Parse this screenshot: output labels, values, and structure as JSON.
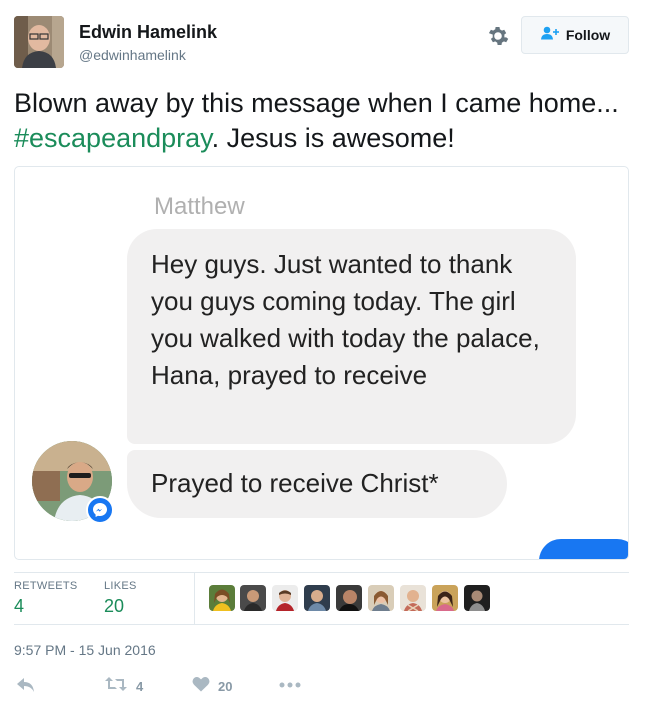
{
  "author": {
    "name": "Edwin Hamelink",
    "handle": "@edwinhamelink"
  },
  "header": {
    "follow_label": "Follow"
  },
  "tweet": {
    "text_before": "Blown away by this message when I came home... ",
    "hashtag": "#escapeandpray",
    "text_after": ". Jesus is awesome!"
  },
  "media": {
    "sender_name": "Matthew",
    "messages": [
      "Hey guys. Just wanted to thank you guys coming today. The girl you walked with today the palace, Hana, prayed to receive",
      "Prayed to receive Christ*"
    ]
  },
  "stats": {
    "retweets_label": "RETWEETS",
    "retweets_value": "4",
    "likes_label": "LIKES",
    "likes_value": "20"
  },
  "timestamp": "9:57 PM - 15 Jun 2016",
  "actions": {
    "retweet_count": "4",
    "like_count": "20"
  },
  "colors": {
    "hashtag": "#1b8c5a",
    "stat_value": "#1b8c5a",
    "messenger_blue": "#1877f2",
    "bubble_gray": "#f1f0f0"
  },
  "icons": [
    "gear-icon",
    "follow-person-icon",
    "messenger-icon",
    "reply-icon",
    "retweet-icon",
    "heart-icon",
    "more-icon"
  ]
}
